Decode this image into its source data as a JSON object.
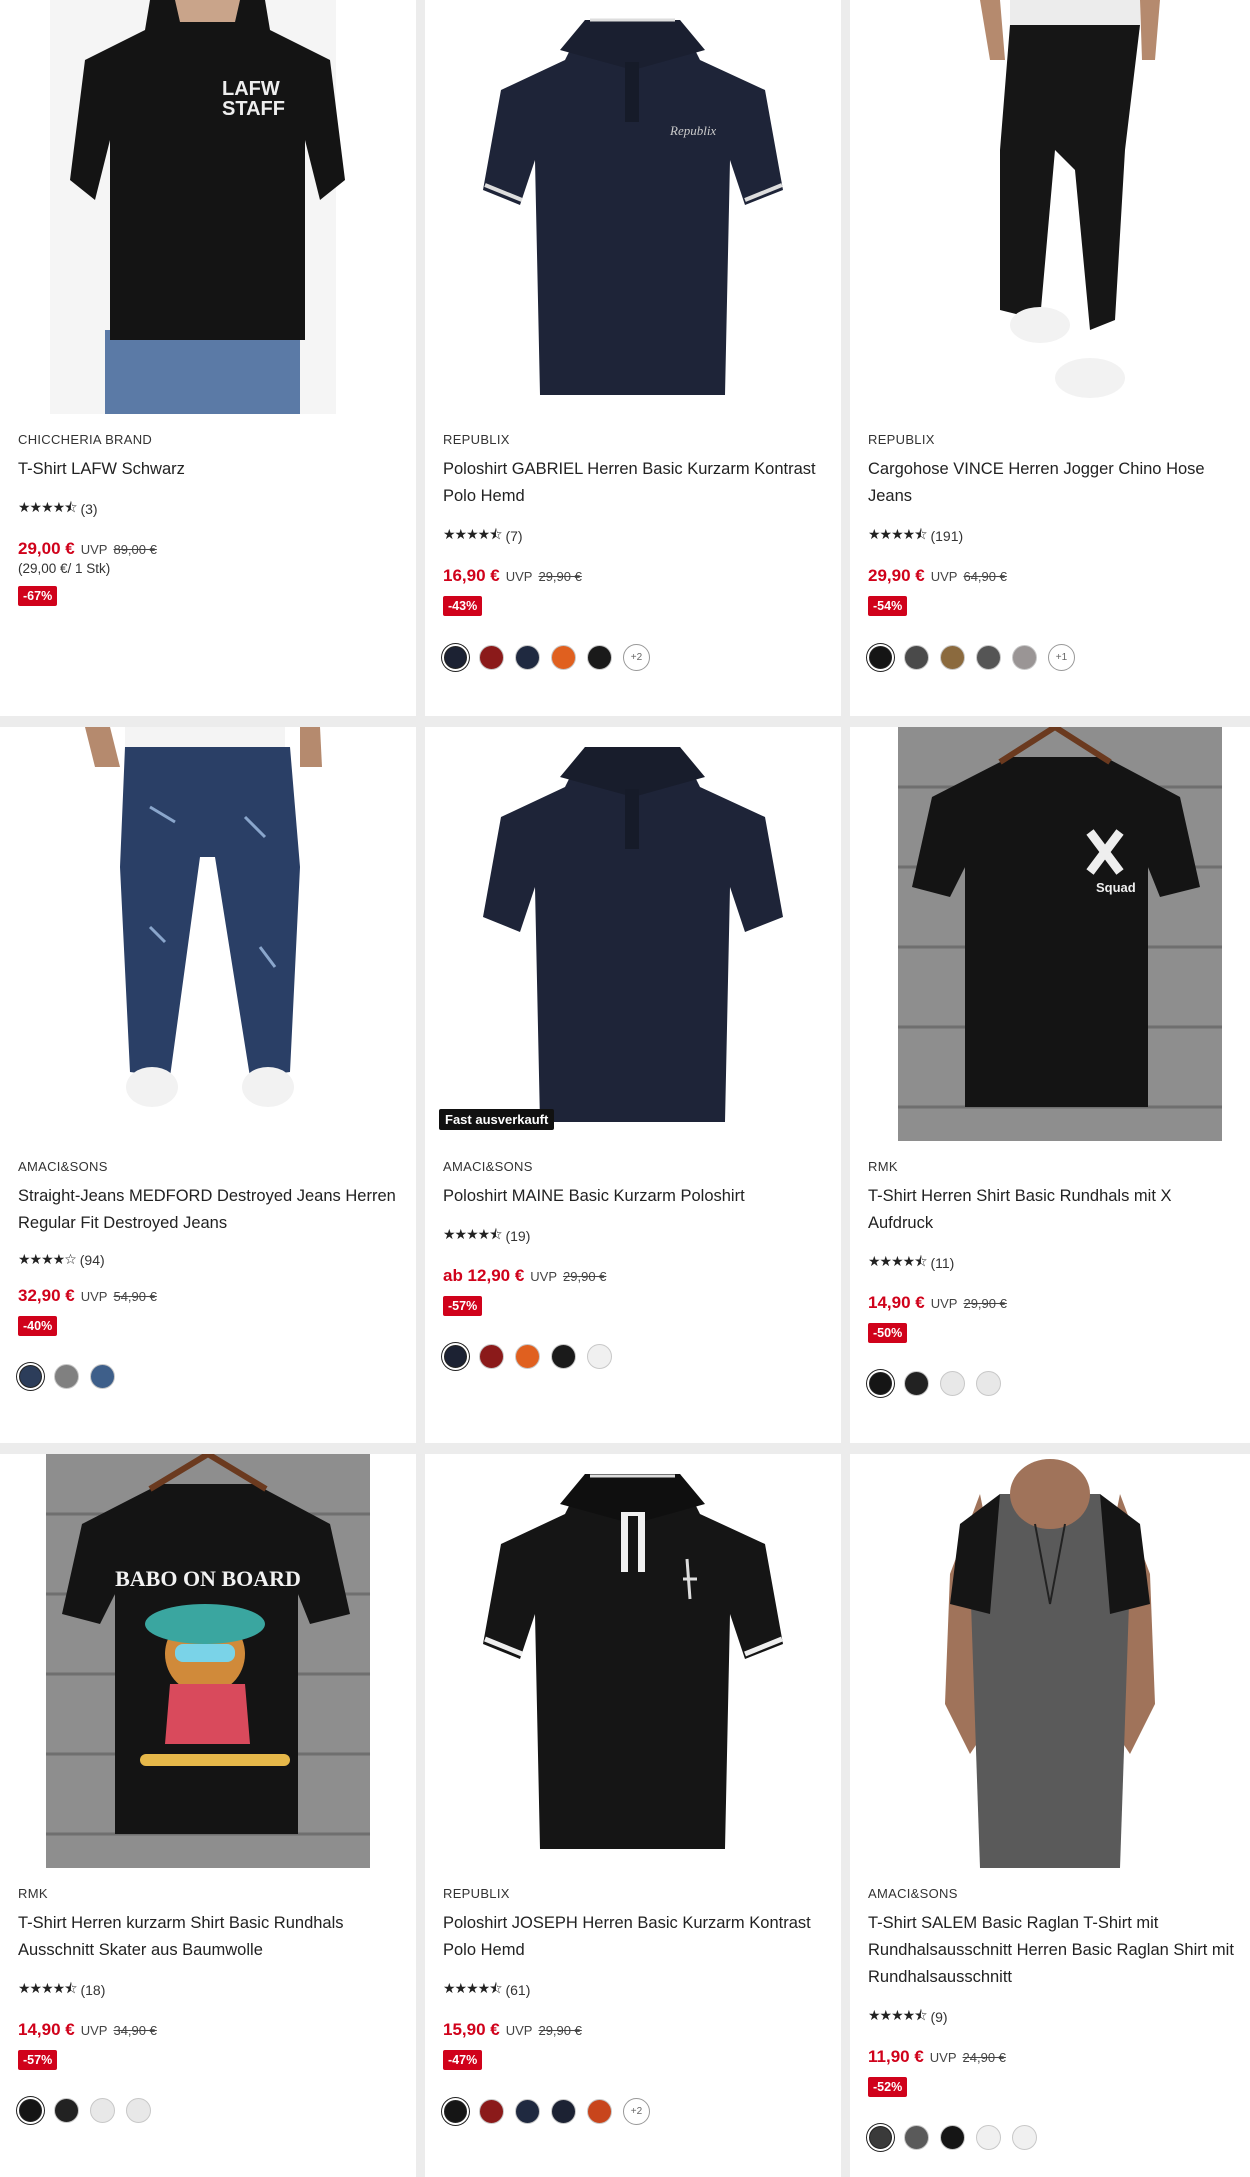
{
  "products": [
    {
      "brand": "CHICCHERIA BRAND",
      "title": "T-Shirt LAFW Schwarz",
      "stars": "★★★★⯪",
      "reviews": "(3)",
      "price": "29,00 €",
      "uvp_label": "UVP",
      "old_price": "89,00 €",
      "unit_price": "(29,00 €/ 1 Stk)",
      "discount": "-67%",
      "print_text": "LAFW\nSTAFF",
      "swatches": []
    },
    {
      "brand": "REPUBLIX",
      "title": "Poloshirt GABRIEL Herren Basic Kurzarm Kontrast Polo Hemd",
      "stars": "★★★★⯪",
      "reviews": "(7)",
      "price": "16,90 €",
      "uvp_label": "UVP",
      "old_price": "29,90 €",
      "discount": "-43%",
      "swatches": [
        "#1c2233",
        "#8b1a1a",
        "#1f2940",
        "#e0601f",
        "#1a1a1a"
      ],
      "more": "+2"
    },
    {
      "brand": "REPUBLIX",
      "title": "Cargohose VINCE Herren Jogger Chino Hose Jeans",
      "stars": "★★★★⯪",
      "reviews": "(191)",
      "price": "29,90 €",
      "uvp_label": "UVP",
      "old_price": "64,90 €",
      "discount": "-54%",
      "swatches": [
        "#151515",
        "#4a4a4a",
        "#8b6a3e",
        "#555555",
        "#9a9595"
      ],
      "more": "+1"
    },
    {
      "brand": "AMACI&SONS",
      "title": "Straight-Jeans MEDFORD Destroyed Jeans Herren Regular Fit Destroyed Jeans",
      "stars": "★★★★☆",
      "reviews": "(94)",
      "price": "32,90 €",
      "uvp_label": "UVP",
      "old_price": "54,90 €",
      "discount": "-40%",
      "swatches": [
        "#2c3d5a",
        "#808080",
        "#3e5f8a"
      ]
    },
    {
      "brand": "AMACI&SONS",
      "title": "Poloshirt MAINE Basic Kurzarm Poloshirt",
      "stars": "★★★★⯪",
      "reviews": "(19)",
      "price": "ab 12,90 €",
      "uvp_label": "UVP",
      "old_price": "29,90 €",
      "discount": "-57%",
      "flag": "Fast ausverkauft",
      "swatches": [
        "#1c2233",
        "#8b1a1a",
        "#e0601f",
        "#1a1a1a",
        "#f0f0f0"
      ]
    },
    {
      "brand": "RMK",
      "title": "T-Shirt Herren Shirt Basic Rundhals mit X Aufdruck",
      "stars": "★★★★⯪",
      "reviews": "(11)",
      "price": "14,90 €",
      "uvp_label": "UVP",
      "old_price": "29,90 €",
      "discount": "-50%",
      "print_text": "Squad",
      "swatches": [
        "#151515",
        "#222222",
        "#e8e8e8",
        "#e8e8e8"
      ]
    },
    {
      "brand": "RMK",
      "title": "T-Shirt Herren kurzarm Shirt Basic Rundhals Ausschnitt Skater aus Baumwolle",
      "stars": "★★★★⯪",
      "reviews": "(18)",
      "price": "14,90 €",
      "uvp_label": "UVP",
      "old_price": "34,90 €",
      "discount": "-57%",
      "print_text": "BABO ON BOARD",
      "swatches": [
        "#151515",
        "#222222",
        "#e8e8e8",
        "#e8e8e8"
      ]
    },
    {
      "brand": "REPUBLIX",
      "title": "Poloshirt JOSEPH Herren Basic Kurzarm Kontrast Polo Hemd",
      "stars": "★★★★⯪",
      "reviews": "(61)",
      "price": "15,90 €",
      "uvp_label": "UVP",
      "old_price": "29,90 €",
      "discount": "-47%",
      "swatches": [
        "#151515",
        "#8b1a1a",
        "#1f2940",
        "#1c2233",
        "#c8451c"
      ],
      "more": "+2"
    },
    {
      "brand": "AMACI&SONS",
      "title": "T-Shirt SALEM Basic Raglan T-Shirt mit Rundhalsausschnitt Herren Basic Raglan Shirt mit Rundhalsausschnitt",
      "stars": "★★★★⯪",
      "reviews": "(9)",
      "price": "11,90 €",
      "uvp_label": "UVP",
      "old_price": "24,90 €",
      "discount": "-52%",
      "swatches": [
        "#3a3a3a",
        "#5a5a5a",
        "#151515",
        "#f0f0f0",
        "#f0f0f0"
      ]
    }
  ]
}
